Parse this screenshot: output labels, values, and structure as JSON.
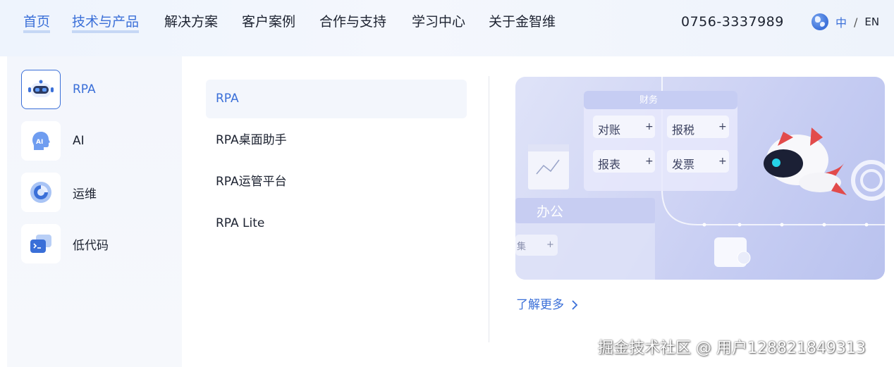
{
  "nav": {
    "items": [
      {
        "label": "首页",
        "active": false
      },
      {
        "label": "技术与产品",
        "active": true
      },
      {
        "label": "解决方案",
        "active": false
      },
      {
        "label": "客户案例",
        "active": false
      },
      {
        "label": "合作与支持",
        "active": false
      },
      {
        "label": "学习中心",
        "active": false
      },
      {
        "label": "关于金智维",
        "active": false
      }
    ],
    "phone": "0756-3337989",
    "lang": {
      "zh": "中",
      "sep": "/",
      "en": "EN"
    }
  },
  "categories": [
    {
      "label": "RPA",
      "icon": "robot-icon",
      "active": true
    },
    {
      "label": "AI",
      "icon": "ai-head-icon",
      "active": false
    },
    {
      "label": "运维",
      "icon": "ops-ring-icon",
      "active": false
    },
    {
      "label": "低代码",
      "icon": "terminal-icon",
      "active": false
    }
  ],
  "products": [
    {
      "label": "RPA",
      "active": true
    },
    {
      "label": "RPA桌面助手",
      "active": false
    },
    {
      "label": "RPA运管平台",
      "active": false
    },
    {
      "label": "RPA Lite",
      "active": false
    }
  ],
  "banner": {
    "panel_title": "财务",
    "chips": [
      "对账",
      "报税",
      "报表",
      "发票"
    ],
    "chip_plus": "+",
    "office_label": "办公",
    "partial_chip": "集"
  },
  "learn_more": "了解更多",
  "watermark": "掘金技术社区 @ 用户128821849313",
  "colors": {
    "accent": "#3a6fd8",
    "text": "#1c2230",
    "panel_bg": "#f3f6fc"
  }
}
